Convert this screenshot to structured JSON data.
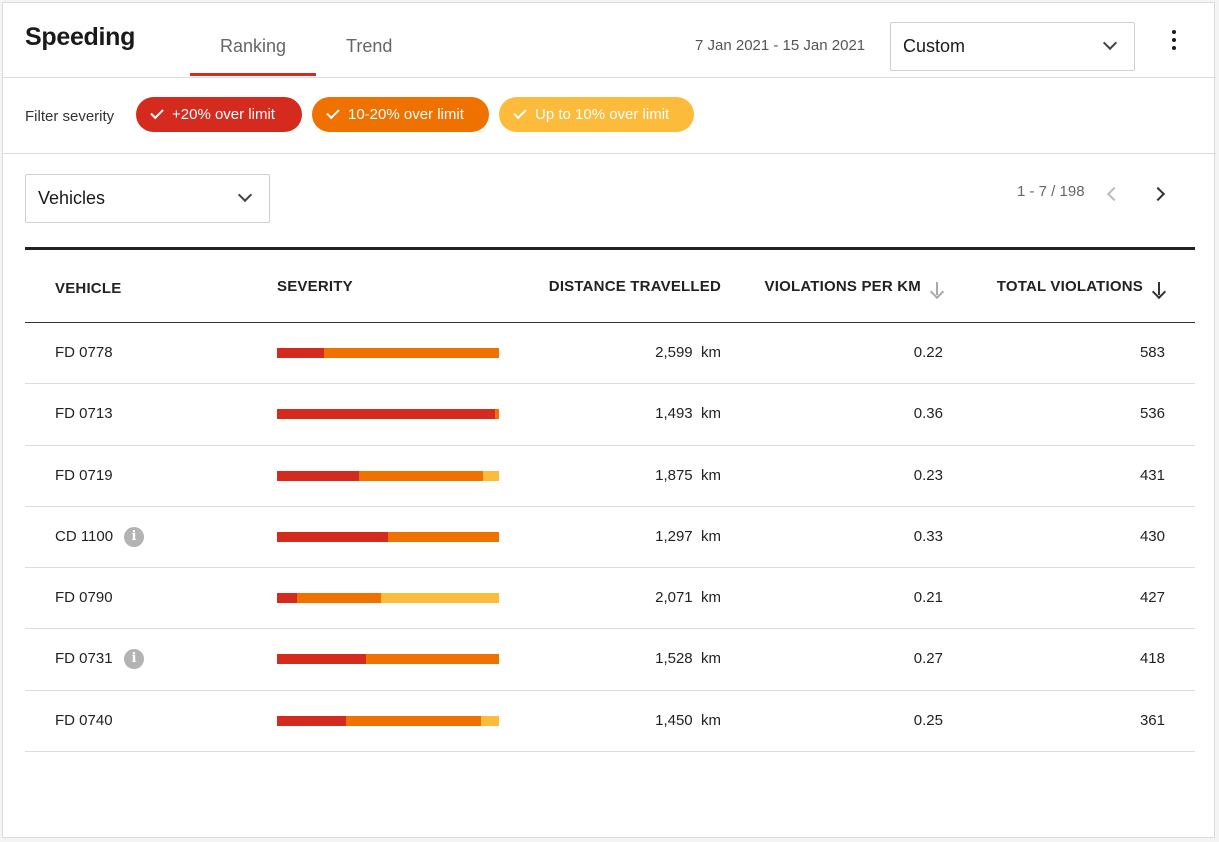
{
  "header": {
    "title": "Speeding",
    "tabs": [
      {
        "label": "Ranking",
        "active": true
      },
      {
        "label": "Trend",
        "active": false
      }
    ],
    "date_range": "7 Jan 2021 - 15 Jan 2021",
    "period_select": "Custom",
    "more_icon": "kebab-icon"
  },
  "filters": {
    "label": "Filter severity",
    "chips": [
      {
        "label": "+20% over limit",
        "color": "#d52b1e",
        "checked": true
      },
      {
        "label": "10-20% over limit",
        "color": "#ef7100",
        "checked": true
      },
      {
        "label": "Up to 10% over limit",
        "color": "#fdbb3c",
        "checked": true
      }
    ]
  },
  "entity_select": "Vehicles",
  "pagination": {
    "label": "1 - 7 / 198"
  },
  "table": {
    "columns": [
      "VEHICLE",
      "SEVERITY",
      "DISTANCE TRAVELLED",
      "VIOLATIONS PER KM",
      "TOTAL VIOLATIONS"
    ],
    "rows": [
      {
        "vehicle": "FD 0778",
        "info": false,
        "severity": [
          0.21,
          0.79,
          0.0
        ],
        "distance": "2,599",
        "unit": "km",
        "vpk": "0.22",
        "total": "583"
      },
      {
        "vehicle": "FD 0713",
        "info": false,
        "severity": [
          0.98,
          0.02,
          0.0
        ],
        "distance": "1,493",
        "unit": "km",
        "vpk": "0.36",
        "total": "536"
      },
      {
        "vehicle": "FD 0719",
        "info": false,
        "severity": [
          0.37,
          0.56,
          0.07
        ],
        "distance": "1,875",
        "unit": "km",
        "vpk": "0.23",
        "total": "431"
      },
      {
        "vehicle": "CD 1100",
        "info": true,
        "severity": [
          0.5,
          0.5,
          0.0
        ],
        "distance": "1,297",
        "unit": "km",
        "vpk": "0.33",
        "total": "430"
      },
      {
        "vehicle": "FD 0790",
        "info": false,
        "severity": [
          0.09,
          0.38,
          0.53
        ],
        "distance": "2,071",
        "unit": "km",
        "vpk": "0.21",
        "total": "427"
      },
      {
        "vehicle": "FD 0731",
        "info": true,
        "severity": [
          0.4,
          0.6,
          0.0
        ],
        "distance": "1,528",
        "unit": "km",
        "vpk": "0.27",
        "total": "418"
      },
      {
        "vehicle": "FD 0740",
        "info": false,
        "severity": [
          0.31,
          0.61,
          0.08
        ],
        "distance": "1,450",
        "unit": "km",
        "vpk": "0.25",
        "total": "361"
      }
    ]
  }
}
